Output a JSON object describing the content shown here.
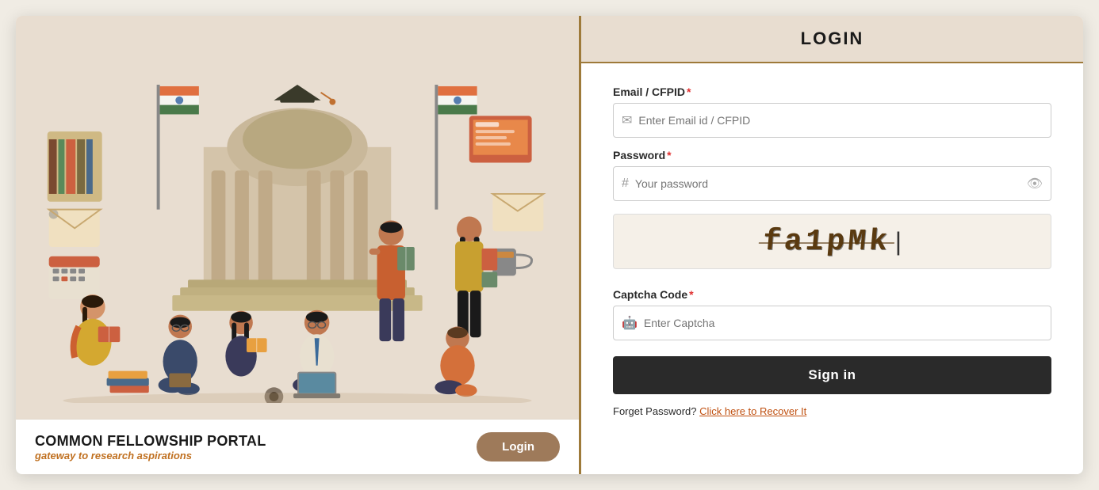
{
  "left": {
    "portal_title": "COMMON FELLOWSHIP PORTAL",
    "portal_subtitle": "gateway to research aspirations",
    "login_btn": "Login"
  },
  "right": {
    "header": "LOGIN",
    "email_label": "Email / CFPID",
    "email_placeholder": "Enter Email id / CFPID",
    "password_label": "Password",
    "password_placeholder": "Your password",
    "captcha_label": "Captcha Code",
    "captcha_placeholder": "Enter Captcha",
    "captcha_value": "fa1pMk",
    "sign_in_btn": "Sign in",
    "forgot_text": "Forget Password?",
    "forgot_link": "Click here to Recover It"
  },
  "icons": {
    "email": "✉",
    "password": "#",
    "captcha": "🤖",
    "eye": "👁"
  }
}
